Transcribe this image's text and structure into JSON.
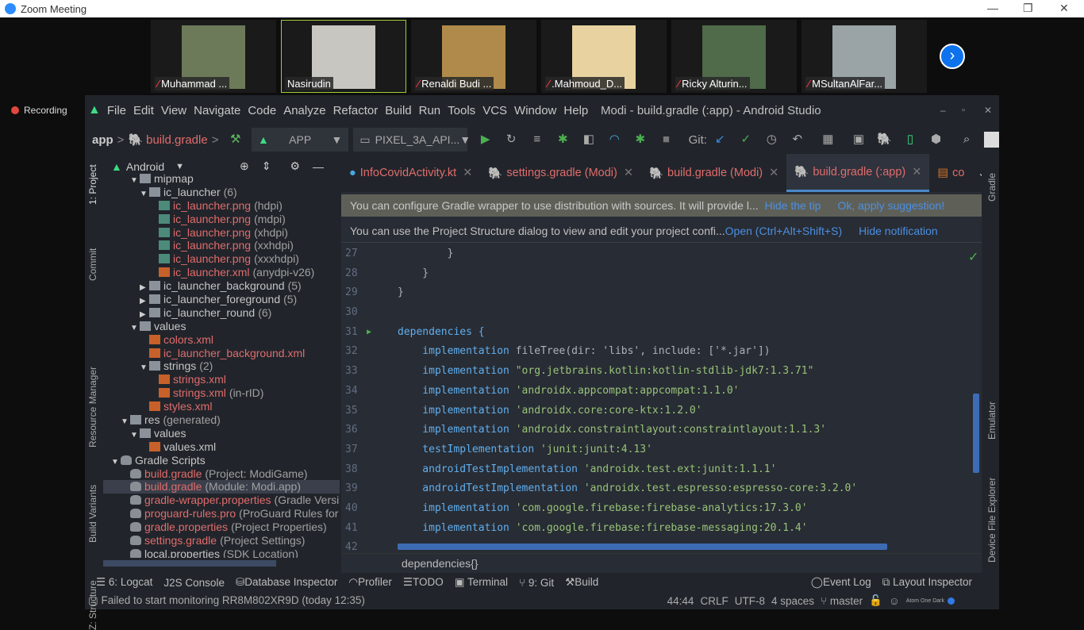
{
  "zoom": {
    "title": "Zoom Meeting",
    "recording": "Recording",
    "participants": [
      {
        "name": "Muhammad ...",
        "muted": true,
        "color": "#6c7a5a"
      },
      {
        "name": "Nasirudin",
        "muted": false,
        "color": "#c8c6c0"
      },
      {
        "name": "Renaldi Budi ...",
        "muted": true,
        "color": "#b08a4a"
      },
      {
        "name": ".Mahmoud_D...",
        "muted": true,
        "color": "#e8d3a0"
      },
      {
        "name": "Ricky Alturin...",
        "muted": true,
        "color": "#4f6b4a"
      },
      {
        "name": "MSultanAlFar...",
        "muted": true,
        "color": "#9aa3a6"
      }
    ]
  },
  "menu": [
    "File",
    "Edit",
    "View",
    "Navigate",
    "Code",
    "Analyze",
    "Refactor",
    "Build",
    "Run",
    "Tools",
    "VCS",
    "Window",
    "Help"
  ],
  "window_title": "Modi - build.gradle (:app) - Android Studio",
  "toolbar": {
    "crumb_app": "app",
    "crumb_file": "build.gradle",
    "run_config": "APP",
    "device": "PIXEL_3A_API...",
    "git_label": "Git:"
  },
  "left_tools": [
    "1: Project",
    "Commit",
    "Resource Manager",
    "Build Variants",
    "Z: Structure"
  ],
  "right_tools": [
    "Gradle",
    "Emulator",
    "Device File Explorer"
  ],
  "project": {
    "view": "Android",
    "tree": [
      {
        "d": 3,
        "a": "▼",
        "i": "fld",
        "t": "mipmap",
        "c": "nrm",
        "s": ""
      },
      {
        "d": 4,
        "a": "▼",
        "i": "fld",
        "t": "ic_launcher",
        "c": "nrm",
        "s": "(6)"
      },
      {
        "d": 5,
        "a": "",
        "i": "png",
        "t": "ic_launcher.png",
        "c": "red",
        "s": "(hdpi)"
      },
      {
        "d": 5,
        "a": "",
        "i": "png",
        "t": "ic_launcher.png",
        "c": "red",
        "s": "(mdpi)"
      },
      {
        "d": 5,
        "a": "",
        "i": "png",
        "t": "ic_launcher.png",
        "c": "red",
        "s": "(xhdpi)"
      },
      {
        "d": 5,
        "a": "",
        "i": "png",
        "t": "ic_launcher.png",
        "c": "red",
        "s": "(xxhdpi)"
      },
      {
        "d": 5,
        "a": "",
        "i": "png",
        "t": "ic_launcher.png",
        "c": "red",
        "s": "(xxxhdpi)"
      },
      {
        "d": 5,
        "a": "",
        "i": "xml",
        "t": "ic_launcher.xml",
        "c": "red",
        "s": "(anydpi-v26)"
      },
      {
        "d": 4,
        "a": "▶",
        "i": "fld",
        "t": "ic_launcher_background",
        "c": "nrm",
        "s": "(5)"
      },
      {
        "d": 4,
        "a": "▶",
        "i": "fld",
        "t": "ic_launcher_foreground",
        "c": "nrm",
        "s": "(5)"
      },
      {
        "d": 4,
        "a": "▶",
        "i": "fld",
        "t": "ic_launcher_round",
        "c": "nrm",
        "s": "(6)"
      },
      {
        "d": 3,
        "a": "▼",
        "i": "fld",
        "t": "values",
        "c": "nrm",
        "s": ""
      },
      {
        "d": 4,
        "a": "",
        "i": "xml",
        "t": "colors.xml",
        "c": "red",
        "s": ""
      },
      {
        "d": 4,
        "a": "",
        "i": "xml",
        "t": "ic_launcher_background.xml",
        "c": "red",
        "s": ""
      },
      {
        "d": 4,
        "a": "▼",
        "i": "fld",
        "t": "strings",
        "c": "nrm",
        "s": "(2)"
      },
      {
        "d": 5,
        "a": "",
        "i": "xml",
        "t": "strings.xml",
        "c": "red",
        "s": ""
      },
      {
        "d": 5,
        "a": "",
        "i": "xml",
        "t": "strings.xml",
        "c": "red",
        "s": "(in-rID)"
      },
      {
        "d": 4,
        "a": "",
        "i": "xml",
        "t": "styles.xml",
        "c": "red",
        "s": ""
      },
      {
        "d": 2,
        "a": "▼",
        "i": "fld",
        "t": "res",
        "c": "nrm",
        "s": "(generated)"
      },
      {
        "d": 3,
        "a": "▼",
        "i": "fld",
        "t": "values",
        "c": "nrm",
        "s": ""
      },
      {
        "d": 4,
        "a": "",
        "i": "xml",
        "t": "values.xml",
        "c": "nrm",
        "s": ""
      },
      {
        "d": 1,
        "a": "▼",
        "i": "gr",
        "t": "Gradle Scripts",
        "c": "nrm",
        "s": ""
      },
      {
        "d": 2,
        "a": "",
        "i": "gr",
        "t": "build.gradle",
        "c": "red",
        "s": "(Project: ModiGame)"
      },
      {
        "d": 2,
        "a": "",
        "i": "gr",
        "t": "build.gradle",
        "c": "red",
        "s": "(Module: Modi.app)",
        "sel": true
      },
      {
        "d": 2,
        "a": "",
        "i": "gr",
        "t": "gradle-wrapper.properties",
        "c": "red",
        "s": "(Gradle Versi"
      },
      {
        "d": 2,
        "a": "",
        "i": "gr",
        "t": "proguard-rules.pro",
        "c": "red",
        "s": "(ProGuard Rules for"
      },
      {
        "d": 2,
        "a": "",
        "i": "gr",
        "t": "gradle.properties",
        "c": "red",
        "s": "(Project Properties)"
      },
      {
        "d": 2,
        "a": "",
        "i": "gr",
        "t": "settings.gradle",
        "c": "red",
        "s": "(Project Settings)"
      },
      {
        "d": 2,
        "a": "",
        "i": "gr",
        "t": "local.properties",
        "c": "nrm",
        "s": "(SDK Location)"
      }
    ]
  },
  "tabs": [
    {
      "label": "InfoCovidActivity.kt"
    },
    {
      "label": "settings.gradle (Modi)"
    },
    {
      "label": "build.gradle (Modi)"
    },
    {
      "label": "build.gradle (:app)",
      "active": true
    },
    {
      "label": "co"
    }
  ],
  "tip": {
    "text": "You can configure Gradle wrapper to use distribution with sources. It will provide l...",
    "hide": "Hide the tip",
    "apply": "Ok, apply suggestion!"
  },
  "notification": {
    "text": "You can use the Project Structure dialog to view and edit your project confi...",
    "open": "Open (Ctrl+Alt+Shift+S)",
    "hide": "Hide notification"
  },
  "code": [
    {
      "n": "27",
      "k": "",
      "r": "        }"
    },
    {
      "n": "28",
      "k": "",
      "r": "    }"
    },
    {
      "n": "29",
      "k": "",
      "r": "}"
    },
    {
      "n": "30",
      "k": "",
      "r": ""
    },
    {
      "n": "31",
      "k": "",
      "r": "dependencies {",
      "f": true
    },
    {
      "n": "32",
      "k": "    implementation ",
      "r": "fileTree(dir: 'libs', include: ['*.jar'])"
    },
    {
      "n": "33",
      "k": "    implementation ",
      "r": "\"org.jetbrains.kotlin:kotlin-stdlib-jdk7:1.3.71\"",
      "s": true
    },
    {
      "n": "34",
      "k": "    implementation ",
      "r": "'androidx.appcompat:appcompat:1.1.0'",
      "s": true
    },
    {
      "n": "35",
      "k": "    implementation ",
      "r": "'androidx.core:core-ktx:1.2.0'",
      "s": true
    },
    {
      "n": "36",
      "k": "    implementation ",
      "r": "'androidx.constraintlayout:constraintlayout:1.1.3'",
      "s": true
    },
    {
      "n": "37",
      "k": "    testImplementation ",
      "r": "'junit:junit:4.13'",
      "s": true
    },
    {
      "n": "38",
      "k": "    androidTestImplementation ",
      "r": "'androidx.test.ext:junit:1.1.1'",
      "s": true
    },
    {
      "n": "39",
      "k": "    androidTestImplementation ",
      "r": "'androidx.test.espresso:espresso-core:3.2.0'",
      "s": true
    },
    {
      "n": "40",
      "k": "    implementation ",
      "r": "'com.google.firebase:firebase-analytics:17.3.0'",
      "s": true
    },
    {
      "n": "41",
      "k": "    implementation ",
      "r": "'com.google.firebase:firebase-messaging:20.1.4'",
      "s": true
    },
    {
      "n": "42",
      "k": "",
      "r": ""
    }
  ],
  "breadcrumb": "dependencies{}",
  "bottom_tools": [
    "6: Logcat",
    "J2S Console",
    "Database Inspector",
    "Profiler",
    "TODO",
    "Terminal",
    "9: Git",
    "Build"
  ],
  "bottom_right": [
    "Event Log",
    "Layout Inspector"
  ],
  "status": {
    "message": "Failed to start monitoring RR8M802XR9D (today 12:35)",
    "position": "44:44",
    "line_sep": "CRLF",
    "encoding": "UTF-8",
    "indent": "4 spaces",
    "branch": "master",
    "theme": "Atom One Dark"
  }
}
